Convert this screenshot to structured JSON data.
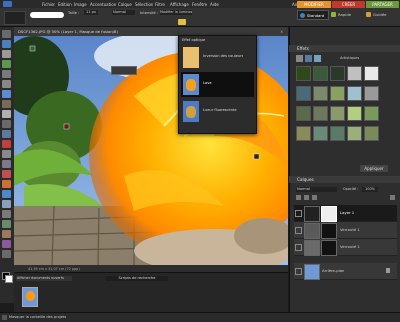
{
  "menubar": {
    "items": [
      "Fichier",
      "Edition",
      "Image",
      "Accentuation",
      "Calque",
      "Sélection",
      "Filtre",
      "Affichage",
      "Fenêtre",
      "Aide"
    ],
    "right_items": [
      "Annuler",
      "Rétablir",
      "Organiser"
    ]
  },
  "options": {
    "size_label": "Taille :",
    "size_value": "11 px",
    "mode_value": "Normal",
    "intensity_label": "Intensité :",
    "mode_button": "Modifier la luminosité"
  },
  "mode_tabs": [
    "MODIFIER",
    "CRÉER",
    "PARTAGER"
  ],
  "edit_buttons": [
    "Standard",
    "Rapide",
    "Guidée"
  ],
  "document": {
    "tab_title": "DSCF1362.JPG @ 50% (Layer 1, Masque de fusion/8)",
    "status": "41,39 cm x 31,07 cm (72 ppp)"
  },
  "popup": {
    "title": "Effet optique",
    "items": [
      {
        "label": "Inversion des couleurs"
      },
      {
        "label": "Lave"
      },
      {
        "label": "Lueur fluorescente"
      }
    ]
  },
  "effects": {
    "title": "Effets",
    "category": "Artistiques",
    "apply_button": "Appliquer"
  },
  "layers": {
    "title": "Calques",
    "blend_mode": "Normal",
    "opacity_label": "Opacité :",
    "opacity_value": "100%",
    "items": [
      {
        "name": "Layer 1"
      },
      {
        "name": "Verrouté 1"
      },
      {
        "name": "Verrouté 1"
      },
      {
        "name": "Arrière-plan"
      }
    ]
  },
  "bin": {
    "dropdown": "Afficher documents ouverts",
    "tab2": "Scripts de recherche"
  },
  "statusbar": {
    "text": "Masquer la corbeille des projets"
  },
  "colors": {
    "accent_orange": "#e8922a",
    "accent_red": "#c0392b",
    "accent_green": "#6a9a3a",
    "selected_layer": "#1a1a1a"
  }
}
